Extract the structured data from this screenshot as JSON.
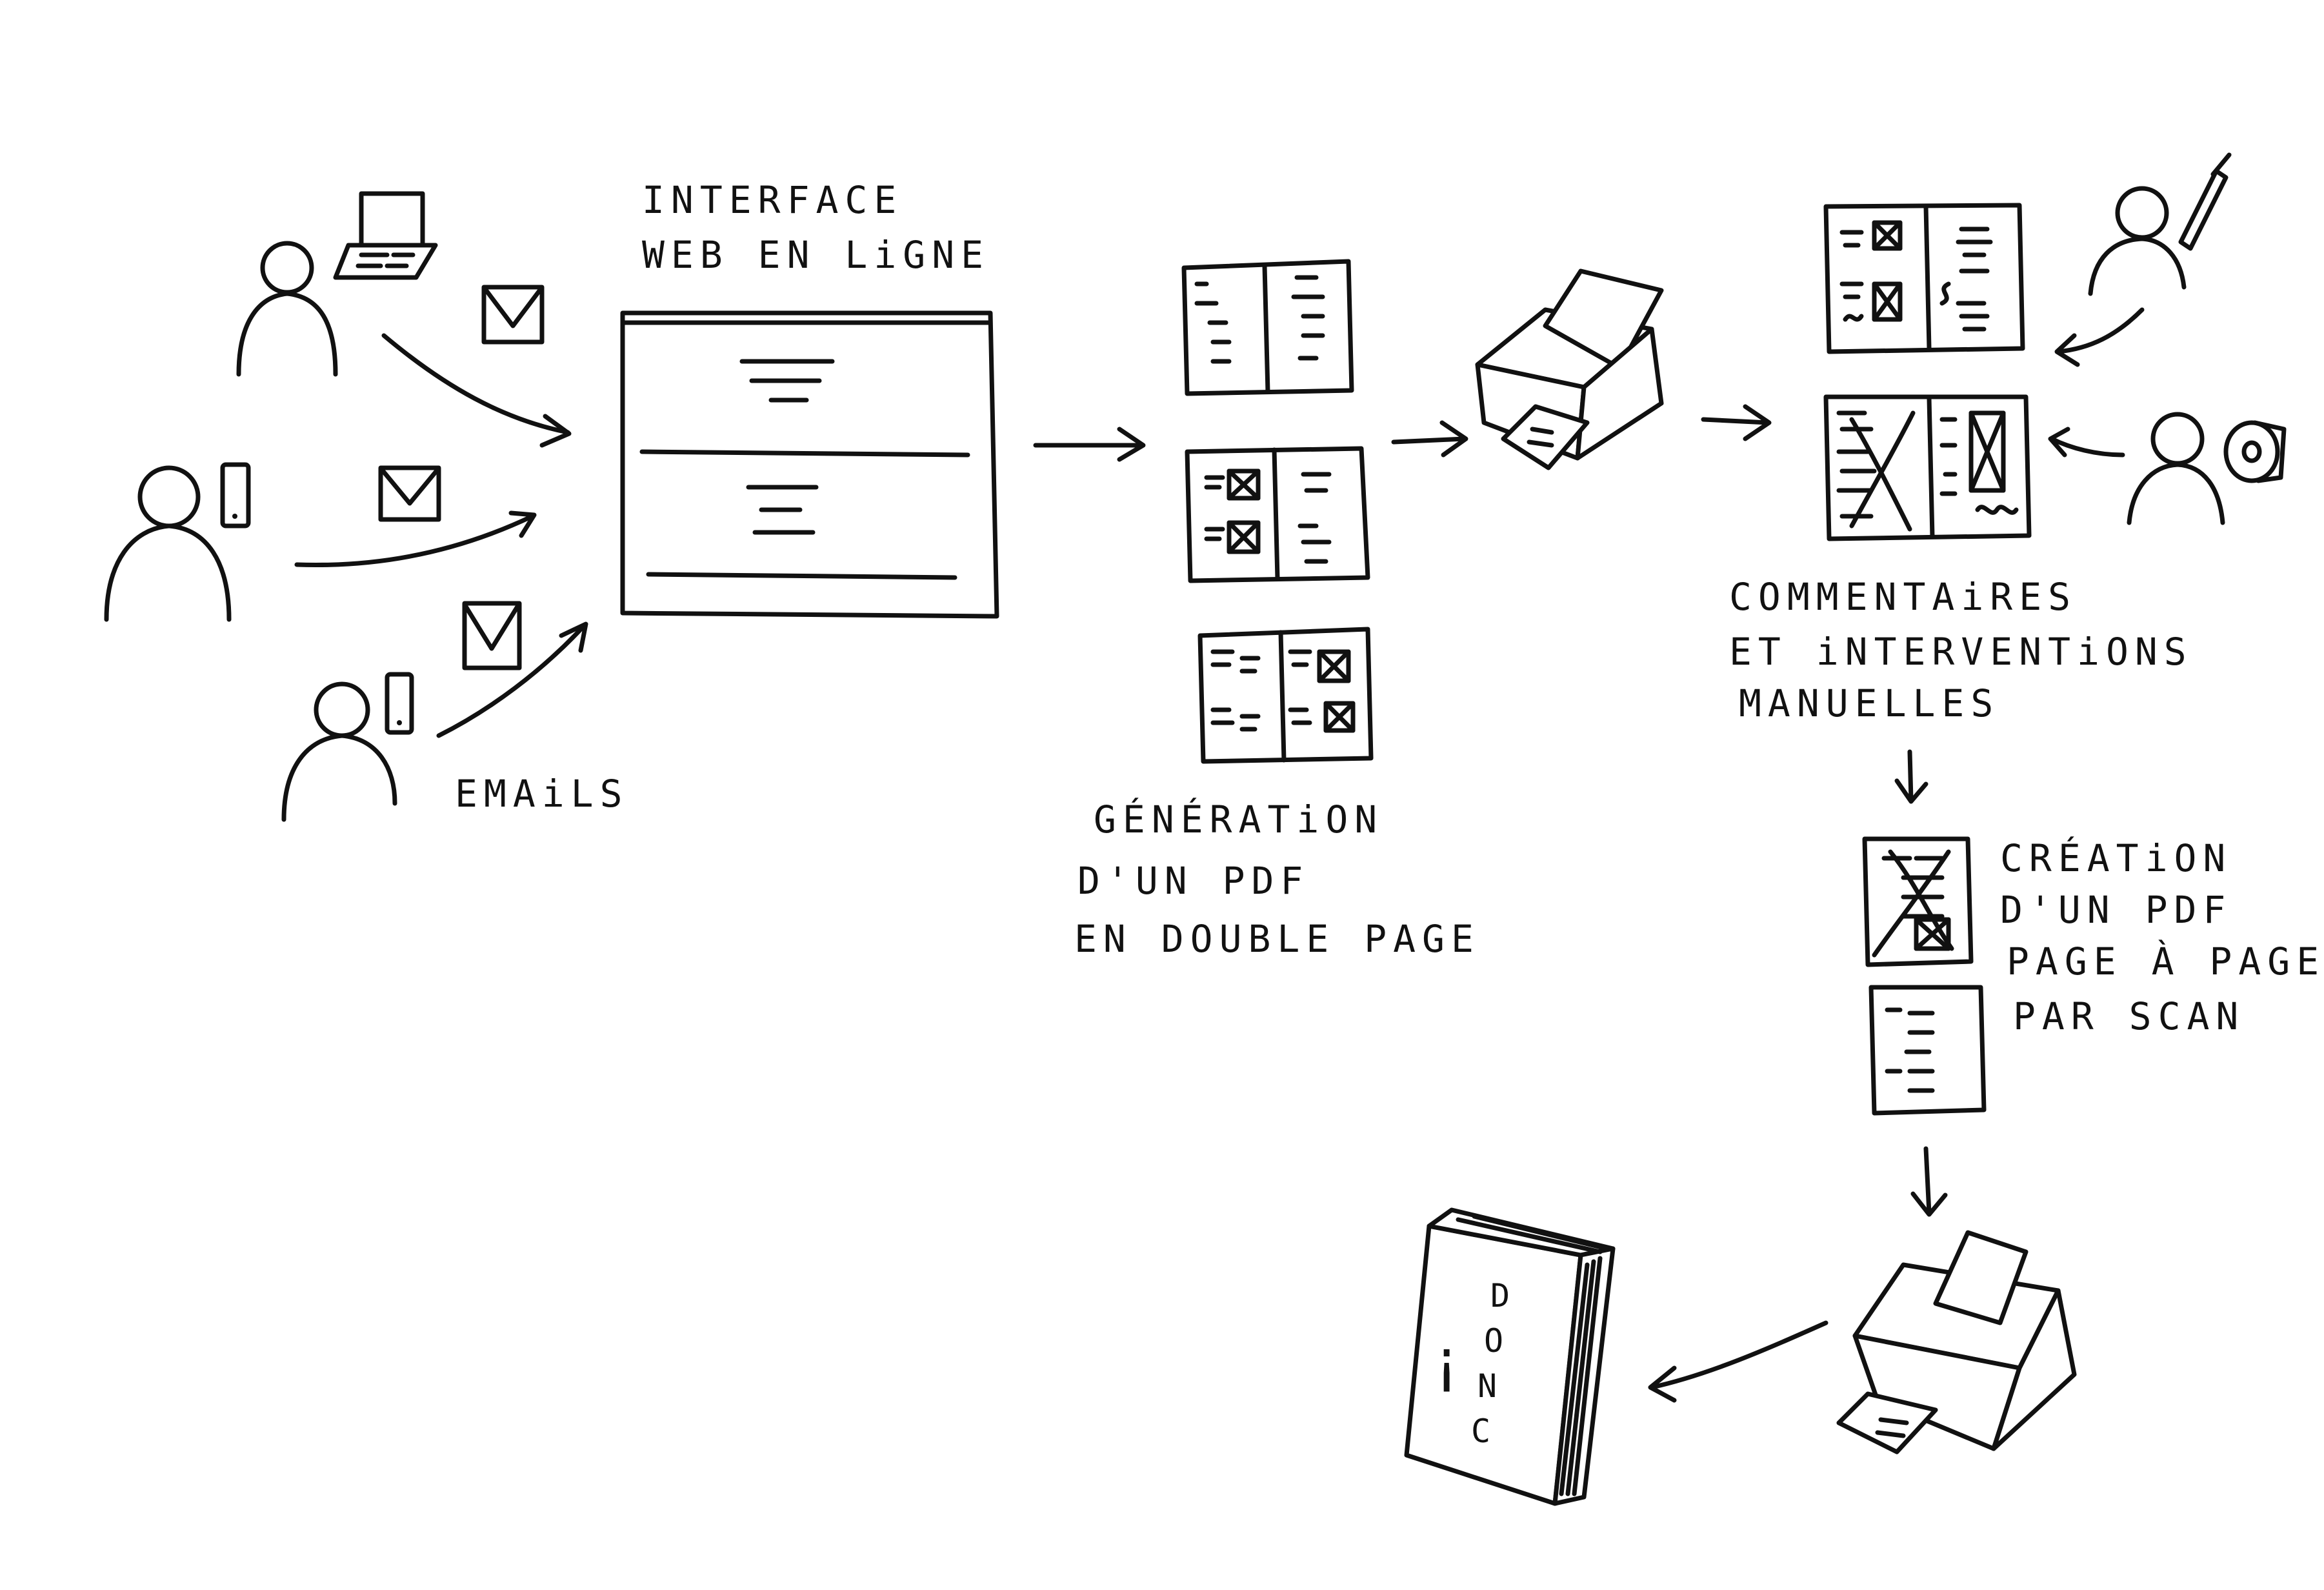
{
  "labels": {
    "interface_line1": "INTERFACE",
    "interface_line2": "WEB EN LiGNE",
    "emails": "EMAiLS",
    "generation_line1": "GÉNÉRATiON",
    "generation_line2": "D'UN PDF",
    "generation_line3": "EN DOUBLE PAGE",
    "commentaires_line1": "COMMENTAiRES",
    "commentaires_line2": "ET iNTERVENTiONS",
    "commentaires_line3": "MANUELLES",
    "creation_line1": "CRÉATiON",
    "creation_line2": "D'UN PDF",
    "creation_line3": "PAGE À PAGE",
    "creation_line4": "PAR SCAN"
  },
  "book": {
    "spine_letters": [
      "D",
      "O",
      "N",
      "C"
    ],
    "mark": "¡"
  },
  "colors": {
    "ink": "#111111",
    "paper": "#ffffff"
  }
}
